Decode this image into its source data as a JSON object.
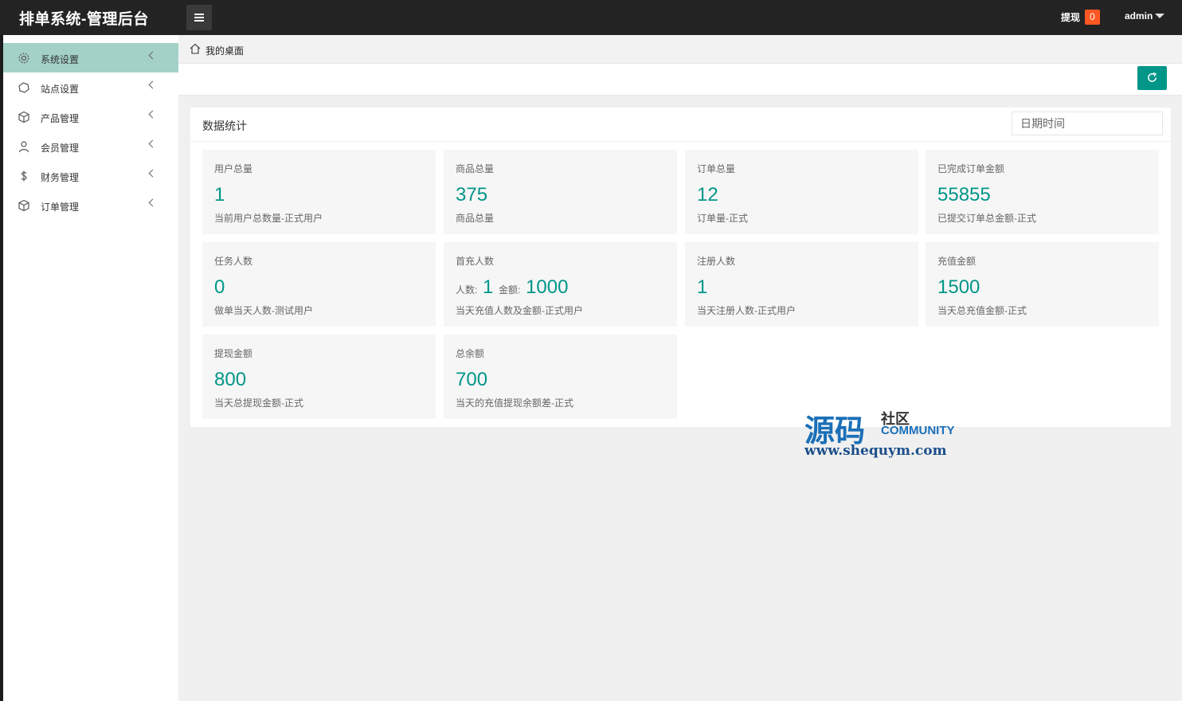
{
  "header": {
    "title": "排单系统-管理后台",
    "withdraw_label": "提现",
    "withdraw_count": "0",
    "user": "admin"
  },
  "sidebar": {
    "items": [
      {
        "label": "系统设置",
        "icon": "gear-icon"
      },
      {
        "label": "站点设置",
        "icon": "globe-icon"
      },
      {
        "label": "产品管理",
        "icon": "cube-icon"
      },
      {
        "label": "会员管理",
        "icon": "user-icon"
      },
      {
        "label": "财务管理",
        "icon": "dollar-icon"
      },
      {
        "label": "订单管理",
        "icon": "cube-icon"
      }
    ]
  },
  "breadcrumb": {
    "label": "我的桌面"
  },
  "panel": {
    "title": "数据统计",
    "date_placeholder": "日期时间"
  },
  "cards": [
    {
      "title": "用户总量",
      "value": "1",
      "desc": "当前用户总数量-正式用户"
    },
    {
      "title": "商品总量",
      "value": "375",
      "desc": "商品总量"
    },
    {
      "title": "订单总量",
      "value": "12",
      "desc": "订单量-正式"
    },
    {
      "title": "已完成订单金额",
      "value": "55855",
      "desc": "已提交订单总金额-正式"
    },
    {
      "title": "任务人数",
      "value": "0",
      "desc": "做单当天人数-测试用户"
    },
    {
      "title": "首充人数",
      "people_label": "人数:",
      "people_value": "1",
      "amount_label": "金额:",
      "amount_value": "1000",
      "desc": "当天充值人数及金额-正式用户"
    },
    {
      "title": "注册人数",
      "value": "1",
      "desc": "当天注册人数-正式用户"
    },
    {
      "title": "充值金额",
      "value": "1500",
      "desc": "当天总充值金额-正式"
    },
    {
      "title": "提现金额",
      "value": "800",
      "desc": "当天总提现金额-正式"
    },
    {
      "title": "总余额",
      "value": "700",
      "desc": "当天的充值提现余额差-正式"
    }
  ],
  "watermark": {
    "big": "源码",
    "cn": "社区",
    "en": "COMMUNITY",
    "url": "www.shequym.com"
  },
  "colors": {
    "accent": "#009688",
    "badge": "#ff5722",
    "topbar": "#232323",
    "active_nav": "#a3d1c8"
  }
}
